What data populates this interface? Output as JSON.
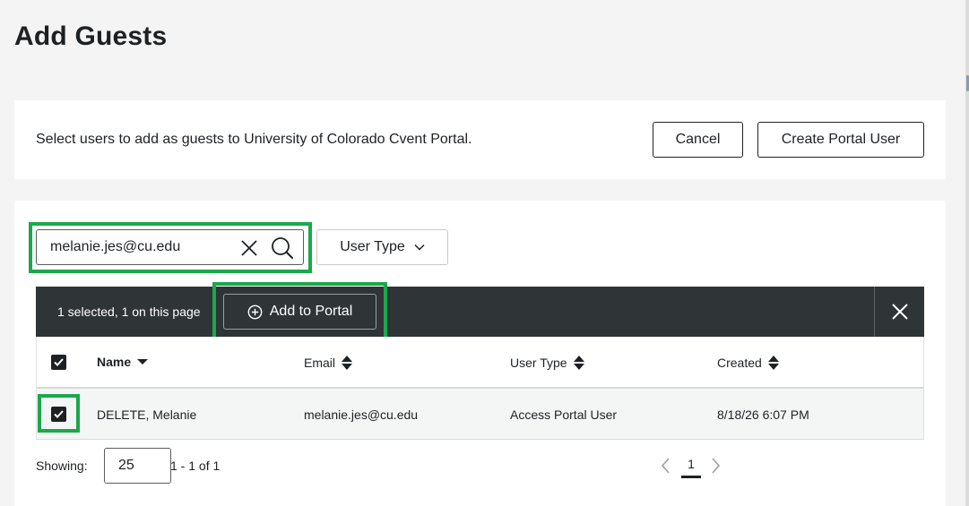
{
  "page": {
    "title": "Add Guests"
  },
  "intro": {
    "text": "Select users to add as guests to University of Colorado Cvent Portal.",
    "cancel_label": "Cancel",
    "create_label": "Create Portal User"
  },
  "search": {
    "value": "melanie.jes@cu.edu"
  },
  "filters": {
    "user_type_label": "User Type"
  },
  "action_bar": {
    "selected_text": "1 selected, 1 on this page",
    "add_label": "Add to Portal"
  },
  "table": {
    "columns": {
      "name": "Name",
      "email": "Email",
      "user_type": "User Type",
      "created": "Created"
    },
    "rows": [
      {
        "name": "DELETE, Melanie",
        "email": "melanie.jes@cu.edu",
        "user_type": "Access Portal User",
        "created": "8/18/26 6:07 PM",
        "selected": true
      }
    ],
    "header_selected": true
  },
  "footer": {
    "showing_label": "Showing:",
    "page_size": "25",
    "range": "1 - 1 of 1",
    "current_page": "1"
  },
  "colors": {
    "highlight": "#1aa84b",
    "action_bar": "#2f3437",
    "text": "#1e2124"
  }
}
